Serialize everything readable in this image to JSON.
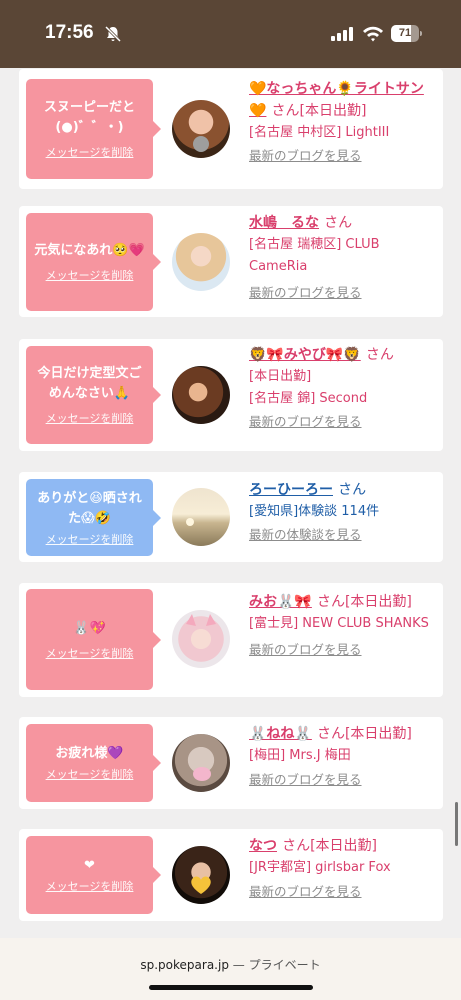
{
  "status_bar": {
    "time": "17:56",
    "battery": "71",
    "battery_level": 0.71
  },
  "cards": [
    {
      "bubble": "スヌーピーだと(●)゛゛・)",
      "bubble_color": "pink",
      "delete_label": "メッセージを削除",
      "name": "🧡なっちゃん🌻ライトサン🧡",
      "suffix": "さん[本日出勤]",
      "location": "[名古屋 中村区] LightIII",
      "extra": "",
      "link": "最新のブログを見る"
    },
    {
      "bubble": "元気になあれ🥺💗",
      "bubble_color": "pink",
      "delete_label": "メッセージを削除",
      "name": "水嶋　るな",
      "suffix": "さん",
      "location": "[名古屋 瑞穂区] CLUB CameRia",
      "extra": "",
      "link": "最新のブログを見る"
    },
    {
      "bubble": "今日だけ定型文ごめんなさい🙏",
      "bubble_color": "pink",
      "delete_label": "メッセージを削除",
      "name": "🦁🎀みやび🎀🦁",
      "suffix": "さん",
      "location": "[本日出勤]",
      "extra": "[名古屋 錦] Second",
      "link": "最新のブログを見る"
    },
    {
      "bubble": "ありがと😆晒された😱🤣",
      "bubble_color": "blue",
      "delete_label": "メッセージを削除",
      "name": "ろーひーろー",
      "suffix": "さん",
      "location": "[愛知県]体験談 114件",
      "extra": "",
      "link": "最新の体験談を見る"
    },
    {
      "bubble": "🐰💖",
      "bubble_color": "pink",
      "delete_label": "メッセージを削除",
      "name": "みお🐰🎀",
      "suffix": "さん[本日出勤]",
      "location": "[富士見] NEW CLUB SHANKS",
      "extra": "",
      "link": "最新のブログを見る"
    },
    {
      "bubble": "お疲れ様💜",
      "bubble_color": "pink",
      "delete_label": "メッセージを削除",
      "name": "🐰ねね🐰",
      "suffix": "さん[本日出勤]",
      "location": "[梅田] Mrs.J 梅田",
      "extra": "",
      "link": "最新のブログを見る"
    },
    {
      "bubble": "❤",
      "bubble_color": "pink",
      "delete_label": "メッセージを削除",
      "name": "なつ",
      "suffix": "さん[本日出勤]",
      "location": "[JR宇都宮] girlsbar Fox",
      "extra": "",
      "link": "最新のブログを見る"
    }
  ],
  "bottom_bar": {
    "domain": "sp.pokepara.jp",
    "separator": " — ",
    "mode": "プライベート"
  },
  "colors": {
    "status_bg": "#5a4636",
    "pink_bubble": "#f6959f",
    "blue_bubble": "#8fb9f3",
    "name_pink": "#d93f6c",
    "name_blue": "#1f5ea7",
    "link_gray": "#8c8c8c"
  }
}
